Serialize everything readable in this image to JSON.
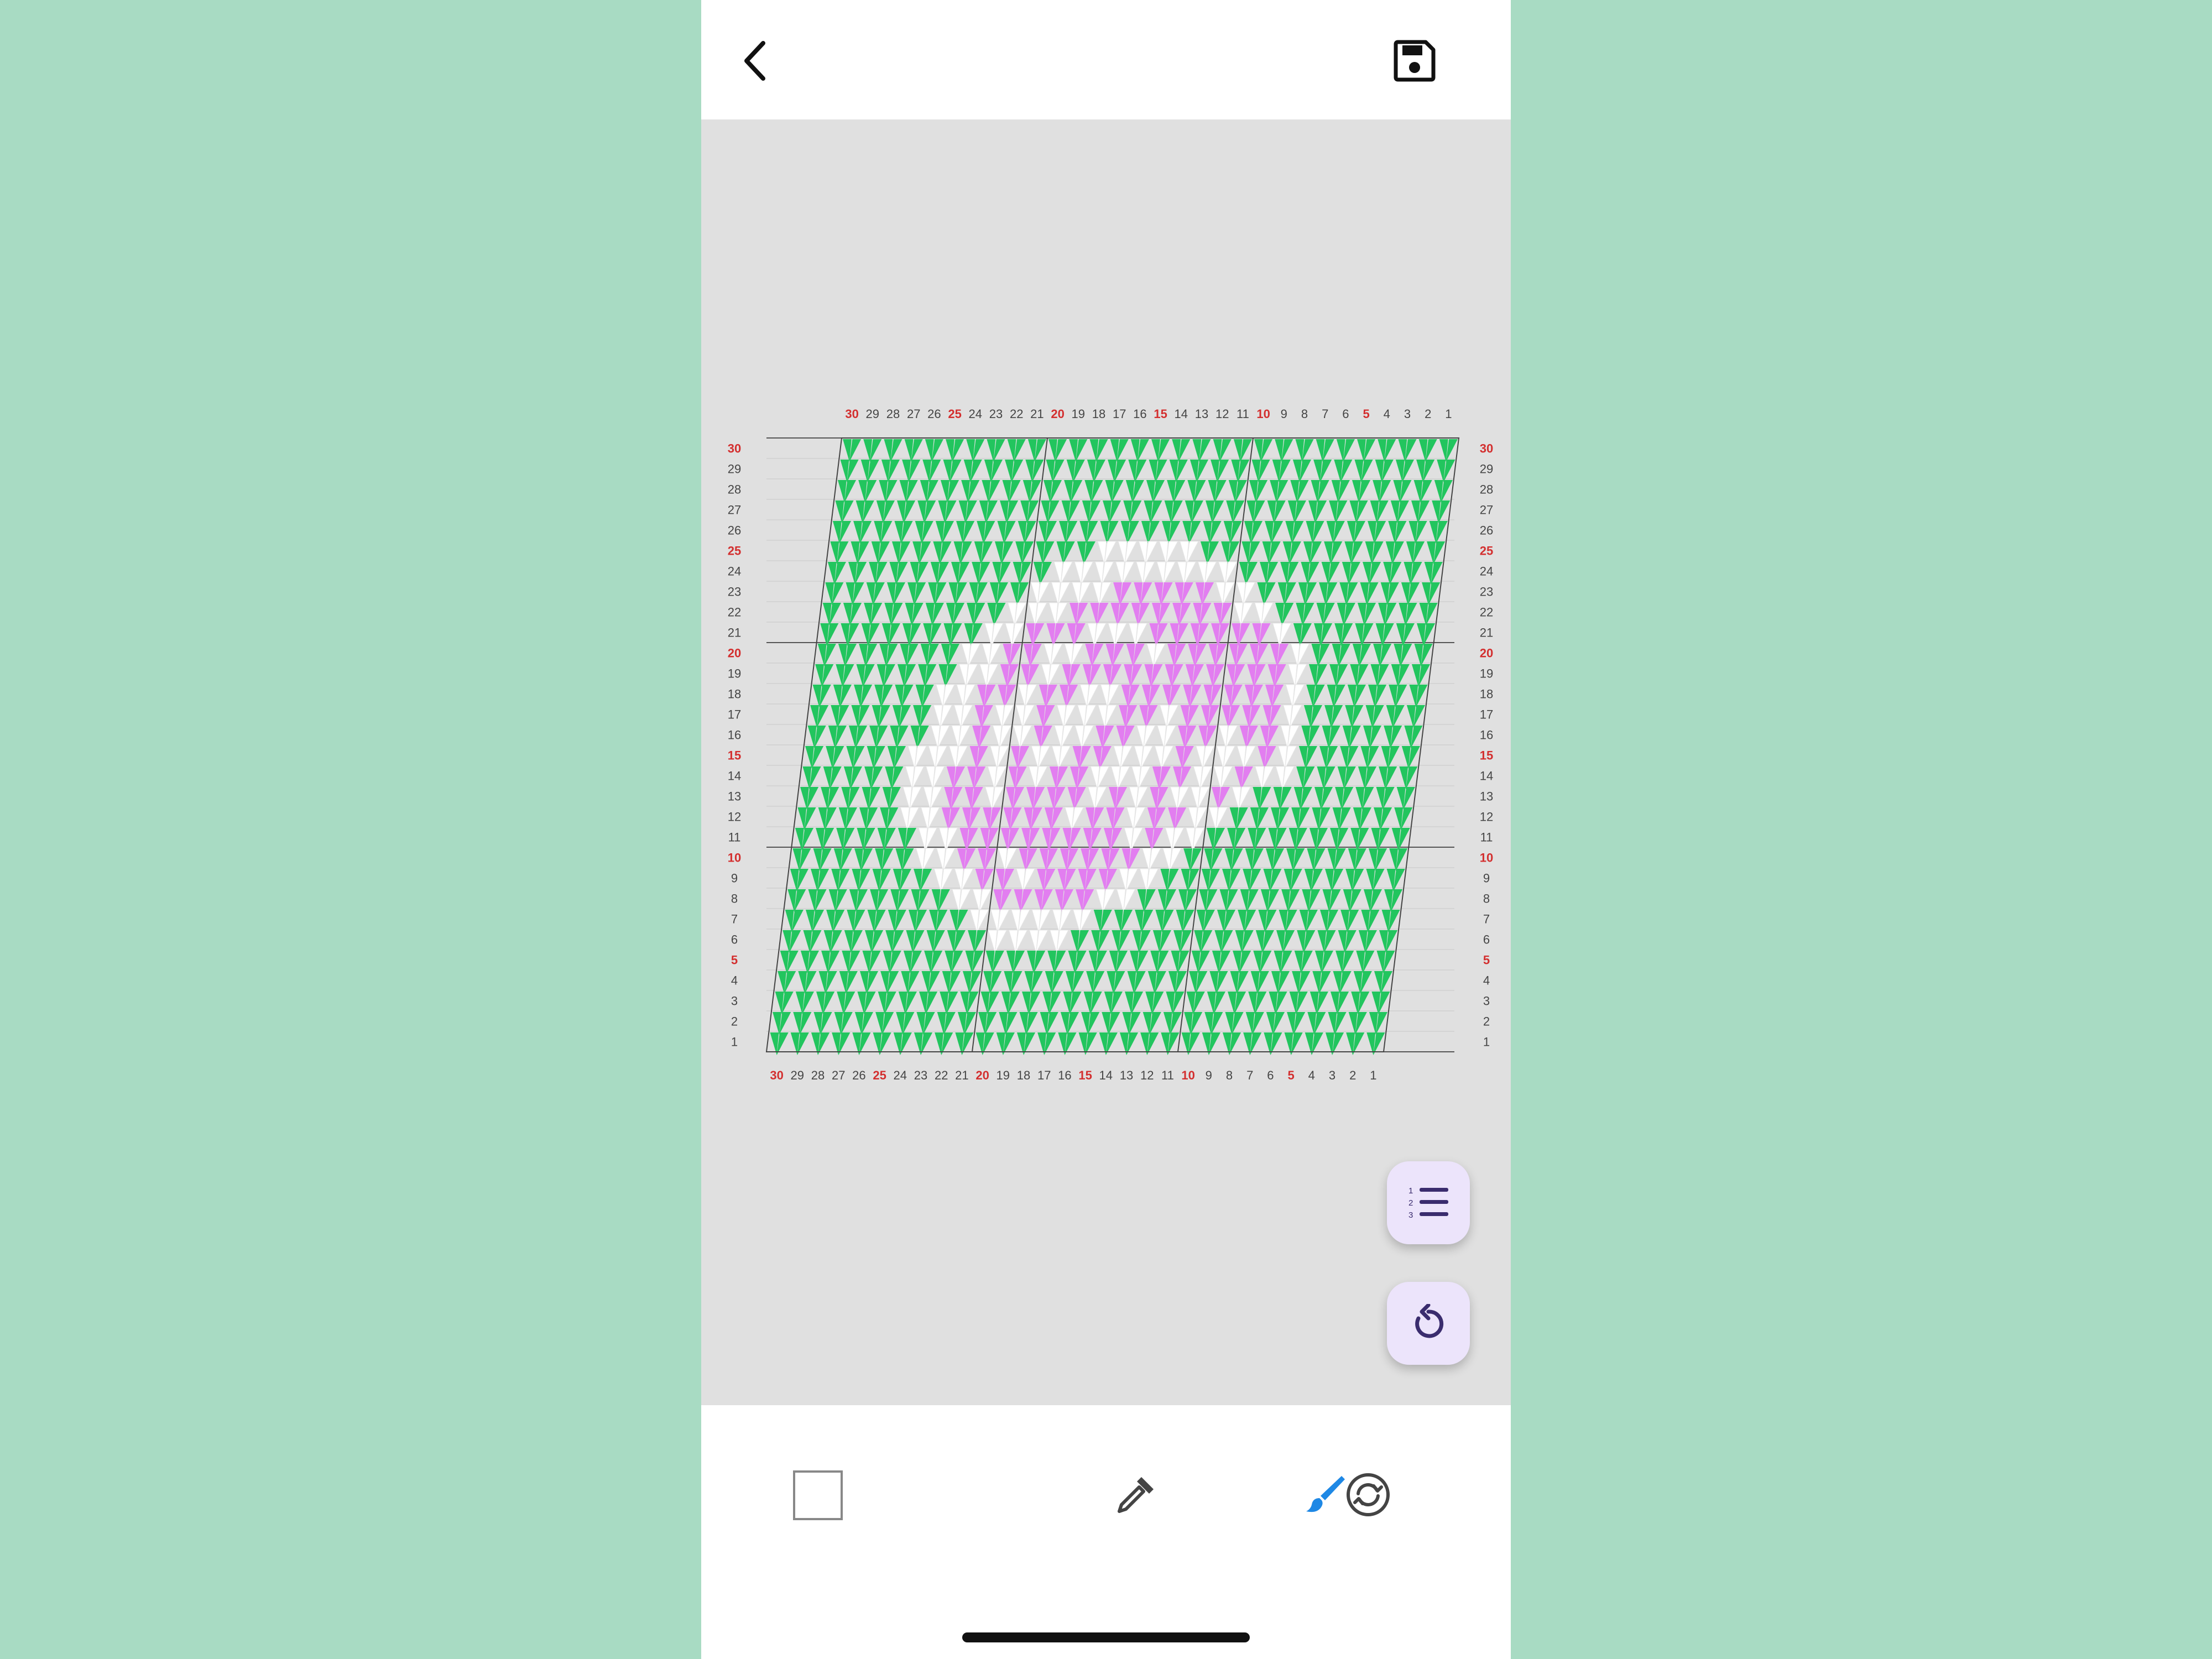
{
  "app": {
    "back_icon": "chevron-left-icon",
    "save_icon": "save-floppy-icon"
  },
  "chart": {
    "rows": 30,
    "cols": 30,
    "red_numbers": [
      5,
      10,
      15,
      20,
      25,
      30
    ],
    "colors": {
      "G": "#22c55e",
      "W": "#ffffff",
      "P": "#e27ef0",
      "number_red": "#d32f2f",
      "number_gray": "#444444"
    },
    "pattern_rows_top_to_bottom": [
      "GGGGGGGGGGGGGGGGGGGGGGGGGGGGGG",
      "GGGGGGGGGGGGGGGGGGGGGGGGGGGGGG",
      "GGGGGGGGGGGGGGGGGGGGGGGGGGGGGG",
      "GGGGGGGGGGGGGGGGGGGGGGGGGGGGGG",
      "GGGGGGGGGGGGGGGGGGGGGGGGGGGGGG",
      "GGGGGGGGGGGGGWWWWWGGGGGGGGGGGG",
      "GGGGGGGGGGGWWWWWWWWWGGGGGGGGGG",
      "GGGGGGGGGGWWWWPPPPPWWGGGGGGGGG",
      "GGGGGGGGGWWWPPPPPPPPWWGGGGGGGG",
      "GGGGGGGGWWPPPWWWPPPPPPWGGGGGGG",
      "GGGGGGGWWPPWWPPPWPPPPPPWGGGGGG",
      "GGGGGGGWWPPWPPPPPPPPPPPWGGGGGG",
      "GGGGGGWWPPWPPWWPPPPPPPPWGGGGGG",
      "GGGGGGWWPWWPWWWPPWPPPPPWGGGGGG",
      "GGGGGGWWPWWPWWPPWWPPWPPWGGGGGG",
      "GGGGGWWWPWPWWPPWWWPWWWPWGGGGGG",
      "GGGGGWWPPWPWPPWWWPPWWPWWGGGGGG",
      "GGGGGWWPPWPPPPWPWPWWPWGGGGGGGG",
      "GGGGGWWPPPPPPWPPWPPWWGGGGGGGGG",
      "GGGGGGWWPPPPPPPPWPWWGGGGGGGGGG",
      "GGGGGGWWPPWPPPPPPWWGGGGGGGGGGG",
      "GGGGGGGWWPPWPPPPWWGGGGGGGGGGGG",
      "GGGGGGGGWWPPPPPWWGGGGGGGGGGGGG",
      "GGGGGGGGGWWWWWWGGGGGGGGGGGGGGG",
      "GGGGGGGGGGWWWWGGGGGGGGGGGGGGGG",
      "GGGGGGGGGGGGGGGGGGGGGGGGGGGGGG",
      "GGGGGGGGGGGGGGGGGGGGGGGGGGGGGG",
      "GGGGGGGGGGGGGGGGGGGGGGGGGGGGGG",
      "GGGGGGGGGGGGGGGGGGGGGGGGGGGGGG",
      "GGGGGGGGGGGGGGGGGGGGGGGGGGGGGG"
    ]
  },
  "fabs": {
    "row_counter_icon": "numbered-list-icon",
    "reset_icon": "rotate-ccw-icon"
  },
  "toolbar": {
    "color_swatch": "#ffffff",
    "eyedropper_icon": "eyedropper-icon",
    "brush_icon": "paint-brush-icon",
    "brush_active_color": "#1e88e5",
    "replace_icon": "color-replace-icon"
  }
}
